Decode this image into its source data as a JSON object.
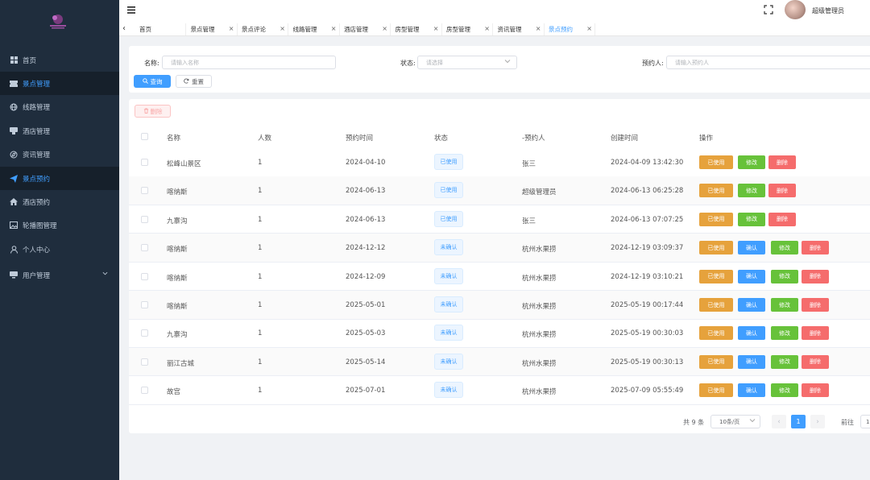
{
  "sidebar": {
    "items": [
      {
        "label": "首页",
        "icon": "dashboard-icon"
      },
      {
        "label": "景点管理",
        "icon": "ticket-icon"
      },
      {
        "label": "线路管理",
        "icon": "globe-icon"
      },
      {
        "label": "酒店管理",
        "icon": "hotel-icon"
      },
      {
        "label": "资讯管理",
        "icon": "compass-icon"
      },
      {
        "label": "景点预约",
        "icon": "paper-plane-icon"
      },
      {
        "label": "酒店预约",
        "icon": "home-icon"
      },
      {
        "label": "轮播图管理",
        "icon": "picture-icon"
      },
      {
        "label": "个人中心",
        "icon": "user-icon"
      },
      {
        "label": "用户管理",
        "icon": "monitor-icon"
      }
    ]
  },
  "header": {
    "admin_name": "超级管理员"
  },
  "tabs": [
    "首页",
    "景点管理",
    "景点评论",
    "线路管理",
    "酒店管理",
    "房型管理",
    "房型管理",
    "资讯管理",
    "景点预约"
  ],
  "search": {
    "name_label": "名称:",
    "name_placeholder": "请输入名称",
    "status_label": "状态:",
    "status_placeholder": "请选择",
    "booker_label": "预约人:",
    "booker_placeholder": "请输入预约人",
    "query_label": "查询",
    "reset_label": "重置"
  },
  "toolbar": {
    "delete_label": "删除"
  },
  "table": {
    "headers": [
      "名称",
      "人数",
      "预约时间",
      "状态",
      "-预约人",
      "创建时间",
      "操作"
    ],
    "rows": [
      {
        "name": "松峰山景区",
        "count": "1",
        "date": "2024-04-10",
        "status": "已使用",
        "booker": "张三",
        "created": "2024-04-09 13:42:30",
        "confirmed": true
      },
      {
        "name": "喀纳斯",
        "count": "1",
        "date": "2024-06-13",
        "status": "已使用",
        "booker": "超级管理员",
        "created": "2024-06-13 06:25:28",
        "confirmed": true
      },
      {
        "name": "九寨沟",
        "count": "1",
        "date": "2024-06-13",
        "status": "已使用",
        "booker": "张三",
        "created": "2024-06-13 07:07:25",
        "confirmed": true
      },
      {
        "name": "喀纳斯",
        "count": "1",
        "date": "2024-12-12",
        "status": "未确认",
        "booker": "杭州水果捞",
        "created": "2024-12-19 03:09:37",
        "confirmed": false
      },
      {
        "name": "喀纳斯",
        "count": "1",
        "date": "2024-12-09",
        "status": "未确认",
        "booker": "杭州水果捞",
        "created": "2024-12-19 03:10:21",
        "confirmed": false
      },
      {
        "name": "喀纳斯",
        "count": "1",
        "date": "2025-05-01",
        "status": "未确认",
        "booker": "杭州水果捞",
        "created": "2025-05-19 00:17:44",
        "confirmed": false
      },
      {
        "name": "九寨沟",
        "count": "1",
        "date": "2025-05-03",
        "status": "未确认",
        "booker": "杭州水果捞",
        "created": "2025-05-19 00:30:03",
        "confirmed": false
      },
      {
        "name": "丽江古城",
        "count": "1",
        "date": "2025-05-14",
        "status": "未确认",
        "booker": "杭州水果捞",
        "created": "2025-05-19 00:30:13",
        "confirmed": false
      },
      {
        "name": "故宫",
        "count": "1",
        "date": "2025-07-01",
        "status": "未确认",
        "booker": "杭州水果捞",
        "created": "2025-07-09 05:55:49",
        "confirmed": false
      }
    ],
    "actions": {
      "used": "已使用",
      "confirm": "确认",
      "edit": "修改",
      "delete": "删除"
    }
  },
  "pagination": {
    "total_text": "共 9 条",
    "page_size": "10条/页",
    "current_page": "1",
    "goto_label": "前往",
    "goto_value": "1"
  }
}
